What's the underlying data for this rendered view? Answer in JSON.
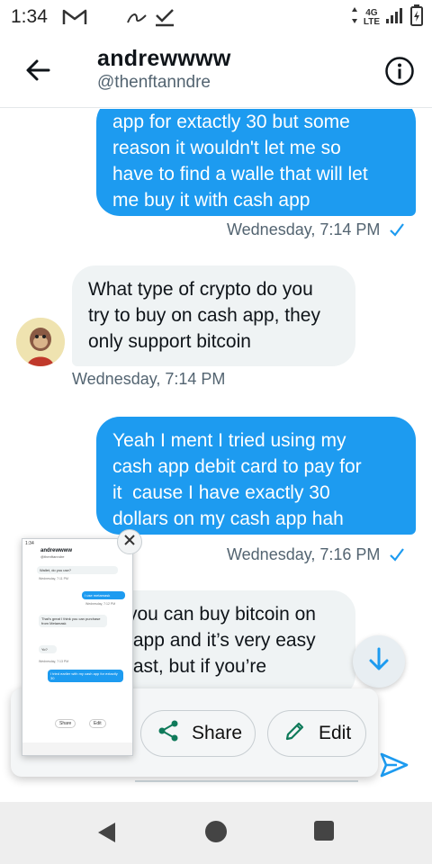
{
  "status_bar": {
    "time": "1:34",
    "network_top": "4G",
    "network_bottom": "LTE",
    "icons": [
      "gmail-icon",
      "signal-icon",
      "check-icon",
      "cell-signal-icon",
      "battery-icon"
    ]
  },
  "header": {
    "title": "andrewwww",
    "handle": "@thenftanndre",
    "back_icon": "back-arrow-icon",
    "info_icon": "info-icon"
  },
  "messages": [
    {
      "direction": "out",
      "lines": [
        "app for extactly 30 but some",
        "reason it wouldn't let me so",
        "have to find a walle that will let",
        "me buy it with cash app"
      ],
      "timestamp": "Wednesday, 7:14 PM",
      "seen": true
    },
    {
      "direction": "in",
      "lines": [
        "What type of crypto do you",
        "try to buy on cash app, they",
        "only support bitcoin"
      ],
      "timestamp": "Wednesday, 7:14 PM"
    },
    {
      "direction": "out",
      "lines": [
        "Yeah I ment I tried using my",
        "cash app debit card to pay for",
        "it  cause I have exactly 30",
        "dollars on my cash app hah"
      ],
      "timestamp": "Wednesday, 7:16 PM",
      "seen": true
    },
    {
      "direction": "in",
      "lines": [
        "you can buy bitcoin on",
        " app and it’s very easy",
        "fast, but if you’re"
      ]
    }
  ],
  "screenshot_overlay": {
    "share_label": "Share",
    "edit_label": "Edit",
    "thumbnail": {
      "status_time": "1:34",
      "title": "andrewwww",
      "handle": "@thenftanndre",
      "bubbles": [
        {
          "direction": "in",
          "text": "Wallet, do you use?"
        },
        {
          "direction": "ts",
          "text": "Wednesday, 7:11 PM"
        },
        {
          "direction": "out",
          "text": "I use metamask"
        },
        {
          "direction": "ts",
          "text": "Wednesday, 7:12 PM"
        },
        {
          "direction": "in",
          "text": "That's great I think you can purchase from Metamask"
        },
        {
          "direction": "in",
          "text": "Yo?"
        },
        {
          "direction": "ts",
          "text": "Wednesday, 7:13 PM"
        },
        {
          "direction": "out",
          "text": "I tried earlier with my cash app for extactly 30"
        }
      ],
      "share_label": "Share",
      "edit_label": "Edit"
    }
  },
  "colors": {
    "accent": "#1d9bf0",
    "incoming_bubble": "#eff3f4",
    "secondary_text": "#536471"
  }
}
